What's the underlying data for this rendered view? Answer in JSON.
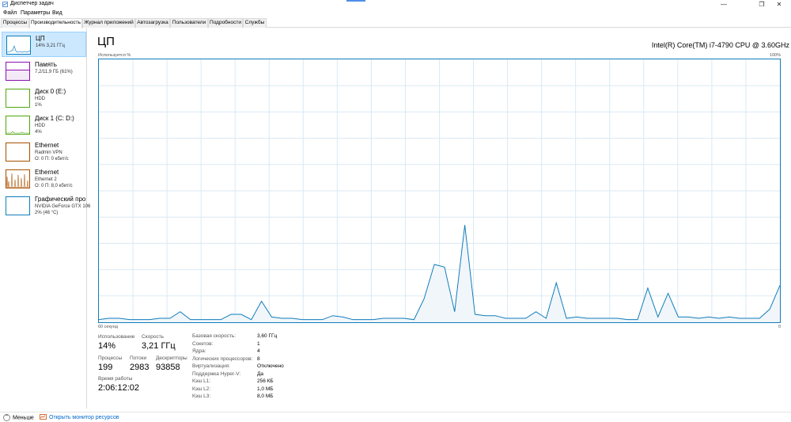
{
  "window": {
    "title": "Диспетчер задач",
    "minimize": "—",
    "maximize": "❐",
    "close": "✕"
  },
  "menu": [
    "Файл",
    "Параметры",
    "Вид"
  ],
  "tabs": [
    "Процессы",
    "Производительность",
    "Журнал приложений",
    "Автозагрузка",
    "Пользователи",
    "Подробности",
    "Службы"
  ],
  "active_tab": 1,
  "sidebar": {
    "items": [
      {
        "title": "ЦП",
        "line1": "14% 3,21 ГГц",
        "line2": "",
        "color": "#117dbb"
      },
      {
        "title": "Память",
        "line1": "7,2/11,9 ГБ (61%)",
        "line2": "",
        "color": "#8b12ae"
      },
      {
        "title": "Диск 0 (E:)",
        "line1": "HDD",
        "line2": "1%",
        "color": "#4da60c"
      },
      {
        "title": "Диск 1 (C: D:)",
        "line1": "HDD",
        "line2": "4%",
        "color": "#4da60c"
      },
      {
        "title": "Ethernet",
        "line1": "Radmin VPN",
        "line2": "О: 0 П: 0 кбит/с",
        "color": "#a74f01"
      },
      {
        "title": "Ethernet",
        "line1": "Ethernet 2",
        "line2": "О: 0 П: 8,0 кбит/с",
        "color": "#a74f01"
      },
      {
        "title": "Графический про",
        "line1": "NVIDIA GeForce GTX 106",
        "line2": "2% (46 °C)",
        "color": "#117dbb"
      }
    ]
  },
  "main": {
    "title": "ЦП",
    "cpu_name": "Intel(R) Core(TM) i7-4790 CPU @ 3.60GHz",
    "graph_label_usage": "Используется %",
    "graph_label_max": "100%",
    "graph_label_time": "60 секунд",
    "graph_label_min": "0",
    "graph_color": "#117dbb",
    "graph_fill": "#f1f6fa",
    "grid_color": "#d9eaf4"
  },
  "chart_data": {
    "type": "area",
    "ylim": [
      0,
      100
    ],
    "xlim": [
      60,
      0
    ],
    "grid": true,
    "values": [
      1,
      1.5,
      1.5,
      1,
      1,
      1,
      1.5,
      1.5,
      4,
      1,
      1,
      1,
      1,
      3,
      3,
      1,
      8,
      2,
      1.5,
      1.5,
      1,
      1,
      1,
      2.5,
      2,
      1,
      1,
      1,
      1.5,
      1.5,
      1.5,
      1,
      9,
      22,
      21,
      4,
      37,
      3,
      2.5,
      2.5,
      1.5,
      1.5,
      1.5,
      4,
      1.5,
      15,
      1.5,
      2,
      1.5,
      1.5,
      1.5,
      1.5,
      1,
      1,
      13,
      2,
      11,
      2,
      2,
      1.5,
      2,
      1.5,
      2,
      1.5,
      1.5,
      1.5,
      5,
      14
    ]
  },
  "stats": {
    "usage_label": "Использование",
    "usage_value": "14%",
    "speed_label": "Скорость",
    "speed_value": "3,21 ГГц",
    "processes_label": "Процессы",
    "processes_value": "199",
    "threads_label": "Потоки",
    "threads_value": "2983",
    "handles_label": "Дескрипторы",
    "handles_value": "93858",
    "uptime_label": "Время работы",
    "uptime_value": "2:06:12:02"
  },
  "details": [
    {
      "key": "Базовая скорость:",
      "value": "3,60 ГГц"
    },
    {
      "key": "Сокетов:",
      "value": "1"
    },
    {
      "key": "Ядра:",
      "value": "4"
    },
    {
      "key": "Логических процессоров:",
      "value": "8"
    },
    {
      "key": "Виртуализация:",
      "value": "Отключено"
    },
    {
      "key": "Поддержка Hyper-V:",
      "value": "Да"
    },
    {
      "key": "Кэш L1:",
      "value": "256 КБ"
    },
    {
      "key": "Кэш L2:",
      "value": "1,0 МБ"
    },
    {
      "key": "Кэш L3:",
      "value": "8,0 МБ"
    }
  ],
  "bottom": {
    "less_label": "Меньше",
    "monitor_label": "Открыть монитор ресурсов"
  }
}
